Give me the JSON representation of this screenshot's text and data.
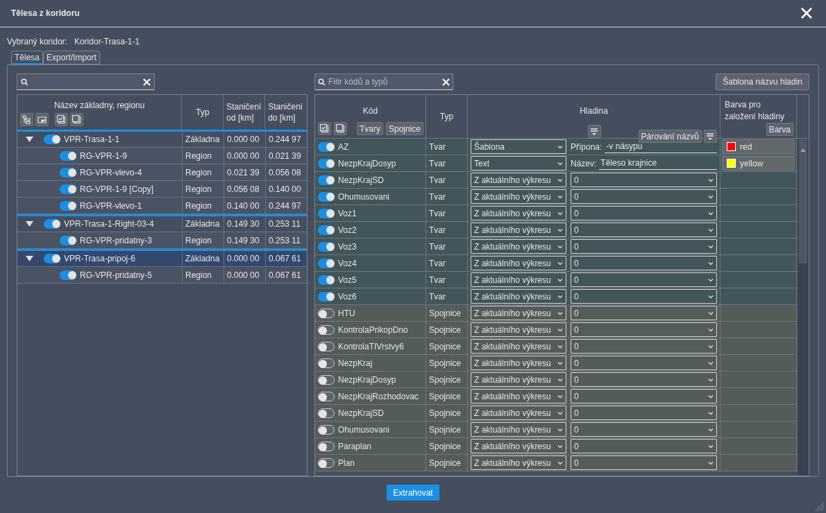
{
  "window": {
    "title": "Tělesa z koridoru"
  },
  "corridor": {
    "label": "Vybraný koridor:",
    "value": "Koridor-Trasa-1-1"
  },
  "tabs": [
    {
      "label": "Tělesa",
      "selected": true
    },
    {
      "label": "Export/Import",
      "selected": false
    }
  ],
  "left": {
    "columns": [
      "Název základny, regionu",
      "Typ",
      "Staničení od [km]",
      "Staničení do [km]"
    ],
    "rows": [
      {
        "name": "VPR-Trasa-1-1",
        "type": "Základna",
        "from": "0.000 00",
        "to": "0.244 97",
        "on": true,
        "expanded": true,
        "selected": false,
        "children": [
          {
            "name": "RG-VPR-1-9",
            "type": "Region",
            "from": "0.000 00",
            "to": "0.021 39",
            "on": true,
            "selected": false
          },
          {
            "name": "RG-VPR-vlevo-4",
            "type": "Region",
            "from": "0.021 39",
            "to": "0.056 08",
            "on": true,
            "selected": false
          },
          {
            "name": "RG-VPR-1-9 [Copy]",
            "type": "Region",
            "from": "0.056 08",
            "to": "0.140 00",
            "on": true,
            "selected": false
          },
          {
            "name": "RG-VPR-vlevo-1",
            "type": "Region",
            "from": "0.140 00",
            "to": "0.244 97",
            "on": true,
            "selected": false
          }
        ]
      },
      {
        "name": "VPR-Trasa-1-Right-03-4",
        "type": "Základna",
        "from": "0.149 30",
        "to": "0.253 11",
        "on": true,
        "expanded": true,
        "selected": false,
        "children": [
          {
            "name": "RG-VPR-pridatny-3",
            "type": "Region",
            "from": "0.149 30",
            "to": "0.253 11",
            "on": true,
            "selected": false
          }
        ]
      },
      {
        "name": "VPR-Trasa-pripoj-6",
        "type": "Základna",
        "from": "0.000 00",
        "to": "0.067 61",
        "on": true,
        "expanded": true,
        "selected": true,
        "children": [
          {
            "name": "RG-VPR-pridatny-5",
            "type": "Region",
            "from": "0.000 00",
            "to": "0.067 61",
            "on": true,
            "selected": false
          }
        ]
      }
    ]
  },
  "right": {
    "filter": {
      "placeholder": "Filtr kódů a typů"
    },
    "template_button": "Šablona názvu hladin",
    "columns": {
      "code": "Kód",
      "type": "Typ",
      "layer": "Hladina",
      "swatch": "Barva pro založení hladiny"
    },
    "header_buttons": {
      "shapes": "Tvary",
      "connectors": "Spojnice",
      "pairing": "Párování názvů",
      "swatch": "Barva"
    },
    "rows": [
      {
        "code": "AZ",
        "on": true,
        "kind": "shape",
        "type": "Tvar",
        "source": "Šablona",
        "field_label": "Přípona:",
        "field_value": "-v násypu",
        "color": "#ff0000",
        "color_name": "red"
      },
      {
        "code": "NezpKrajDosyp",
        "on": true,
        "kind": "shape",
        "type": "Tvar",
        "source": "Text",
        "field_label": "Název:",
        "field_value": "Těleso krajnice",
        "color": "#ffff00",
        "color_name": "yellow"
      },
      {
        "code": "NezpKrajSD",
        "on": true,
        "kind": "shape",
        "type": "Tvar",
        "source": "Z aktuálního výkresu",
        "layer": "0"
      },
      {
        "code": "Ohumusovani",
        "on": true,
        "kind": "shape",
        "type": "Tvar",
        "source": "Z aktuálního výkresu",
        "layer": "0"
      },
      {
        "code": "Voz1",
        "on": true,
        "kind": "shape",
        "type": "Tvar",
        "source": "Z aktuálního výkresu",
        "layer": "0"
      },
      {
        "code": "Voz2",
        "on": true,
        "kind": "shape",
        "type": "Tvar",
        "source": "Z aktuálního výkresu",
        "layer": "0"
      },
      {
        "code": "Voz3",
        "on": true,
        "kind": "shape",
        "type": "Tvar",
        "source": "Z aktuálního výkresu",
        "layer": "0"
      },
      {
        "code": "Voz4",
        "on": true,
        "kind": "shape",
        "type": "Tvar",
        "source": "Z aktuálního výkresu",
        "layer": "0"
      },
      {
        "code": "Voz5",
        "on": true,
        "kind": "shape",
        "type": "Tvar",
        "source": "Z aktuálního výkresu",
        "layer": "0"
      },
      {
        "code": "Voz6",
        "on": true,
        "kind": "shape",
        "type": "Tvar",
        "source": "Z aktuálního výkresu",
        "layer": "0"
      },
      {
        "code": "HTU",
        "on": false,
        "kind": "connector",
        "type": "Spojnice",
        "source": "Z aktuálního výkresu",
        "layer": "0"
      },
      {
        "code": "KontrolaPrikopDno",
        "on": false,
        "kind": "connector",
        "type": "Spojnice",
        "source": "Z aktuálního výkresu",
        "layer": "0"
      },
      {
        "code": "KontrolaTIVrstvy6",
        "on": false,
        "kind": "connector",
        "type": "Spojnice",
        "source": "Z aktuálního výkresu",
        "layer": "0"
      },
      {
        "code": "NezpKraj",
        "on": false,
        "kind": "connector",
        "type": "Spojnice",
        "source": "Z aktuálního výkresu",
        "layer": "0"
      },
      {
        "code": "NezpKrajDosyp",
        "on": false,
        "kind": "connector",
        "type": "Spojnice",
        "source": "Z aktuálního výkresu",
        "layer": "0"
      },
      {
        "code": "NezpKrajRozhodovac",
        "on": false,
        "kind": "connector",
        "type": "Spojnice",
        "source": "Z aktuálního výkresu",
        "layer": "0"
      },
      {
        "code": "NezpKrajSD",
        "on": false,
        "kind": "connector",
        "type": "Spojnice",
        "source": "Z aktuálního výkresu",
        "layer": "0"
      },
      {
        "code": "Ohumusovani",
        "on": false,
        "kind": "connector",
        "type": "Spojnice",
        "source": "Z aktuálního výkresu",
        "layer": "0"
      },
      {
        "code": "Paraplan",
        "on": false,
        "kind": "connector",
        "type": "Spojnice",
        "source": "Z aktuálního výkresu",
        "layer": "0"
      },
      {
        "code": "Plan",
        "on": false,
        "kind": "connector",
        "type": "Spojnice",
        "source": "Z aktuálního výkresu",
        "layer": "0"
      }
    ]
  },
  "action": "Extrahovat"
}
